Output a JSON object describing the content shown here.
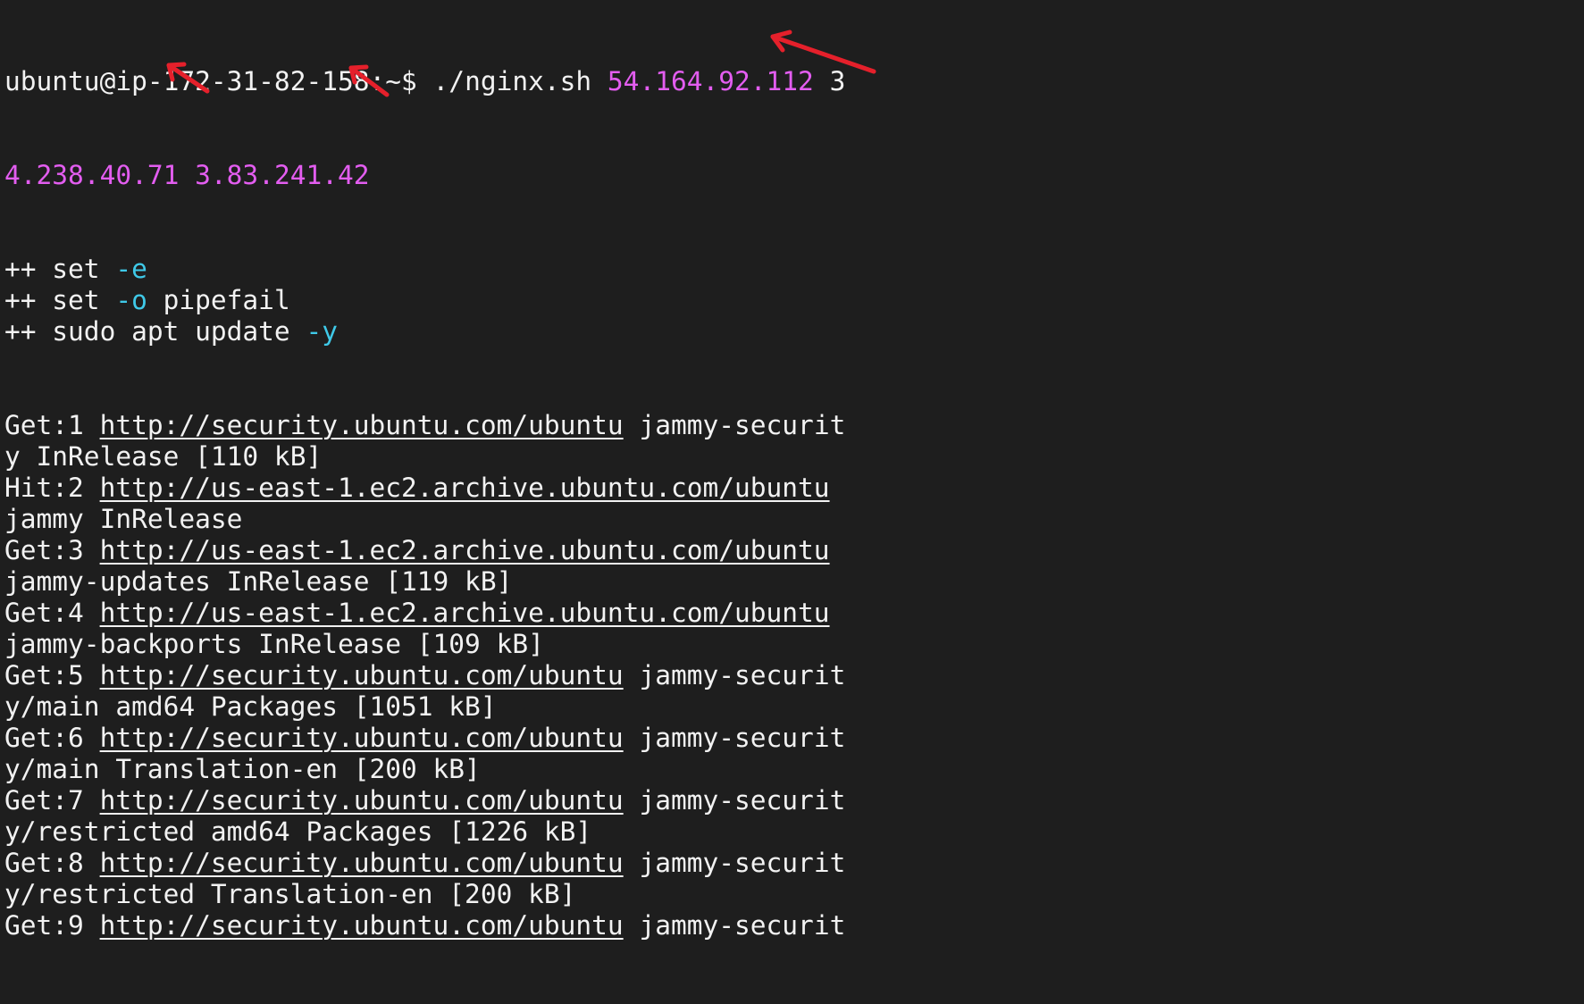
{
  "terminal": {
    "colors": {
      "background": "#1e1e1e",
      "foreground": "#f2f2f2",
      "argument": "#e35df0",
      "flag": "#3fc9e8",
      "annotation_arrow": "#e5202b"
    },
    "prompt": {
      "text": "ubuntu@ip-172-31-82-158:~$ ",
      "command": "./nginx.sh ",
      "arg1": "54.164.92.112",
      "arg2_wrap_start": " 3",
      "arg2_wrap_end": "4.238.40.71",
      "space": " ",
      "arg3": "3.83.241.42"
    },
    "trace": [
      {
        "prefix": "++ set ",
        "flag": "-e",
        "rest": ""
      },
      {
        "prefix": "++ set ",
        "flag": "-o",
        "rest": " pipefail"
      },
      {
        "prefix": "++ sudo apt update ",
        "flag": "-y",
        "rest": ""
      }
    ],
    "apt": [
      {
        "tag": "Get:1 ",
        "url": "http://security.ubuntu.com/ubuntu",
        "suite_start": " jammy-securit",
        "rest": "y InRelease [110 kB]"
      },
      {
        "tag": "Hit:2 ",
        "url": "http://us-east-1.ec2.archive.ubuntu.com/ubuntu",
        "suite_start": "",
        "rest": "jammy InRelease"
      },
      {
        "tag": "Get:3 ",
        "url": "http://us-east-1.ec2.archive.ubuntu.com/ubuntu",
        "suite_start": "",
        "rest": "jammy-updates InRelease [119 kB]"
      },
      {
        "tag": "Get:4 ",
        "url": "http://us-east-1.ec2.archive.ubuntu.com/ubuntu",
        "suite_start": "",
        "rest": "jammy-backports InRelease [109 kB]"
      },
      {
        "tag": "Get:5 ",
        "url": "http://security.ubuntu.com/ubuntu",
        "suite_start": " jammy-securit",
        "rest": "y/main amd64 Packages [1051 kB]"
      },
      {
        "tag": "Get:6 ",
        "url": "http://security.ubuntu.com/ubuntu",
        "suite_start": " jammy-securit",
        "rest": "y/main Translation-en [200 kB]"
      },
      {
        "tag": "Get:7 ",
        "url": "http://security.ubuntu.com/ubuntu",
        "suite_start": " jammy-securit",
        "rest": "y/restricted amd64 Packages [1226 kB]"
      },
      {
        "tag": "Get:8 ",
        "url": "http://security.ubuntu.com/ubuntu",
        "suite_start": " jammy-securit",
        "rest": "y/restricted Translation-en [200 kB]"
      },
      {
        "tag": "Get:9 ",
        "url": "http://security.ubuntu.com/ubuntu",
        "suite_start": " jammy-securit",
        "rest": ""
      }
    ]
  }
}
